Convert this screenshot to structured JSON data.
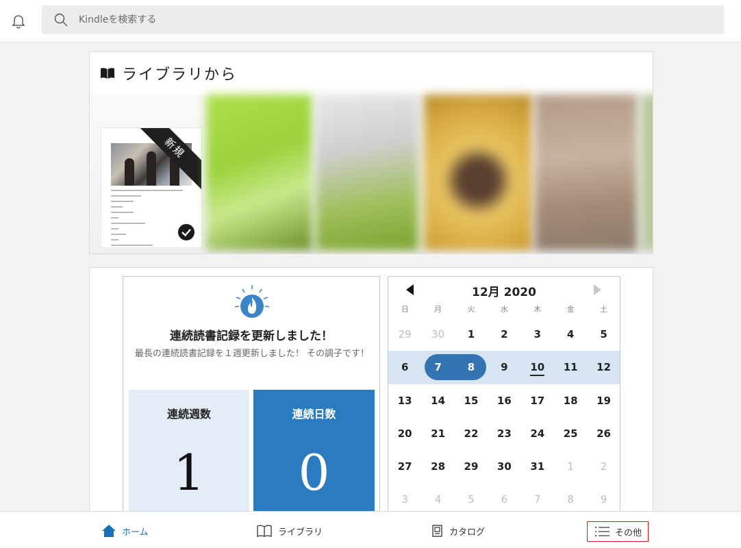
{
  "header": {
    "bell_icon": "bell-icon",
    "search_icon": "search-icon",
    "search_placeholder": "Kindleを検索する"
  },
  "library": {
    "title": "ライブラリから",
    "icon": "open-book-icon",
    "new_badge": "新規",
    "first_book_status_icon": "check-circle-icon"
  },
  "streak": {
    "icon": "flame-icon",
    "heading": "連続読書記録を更新しました！",
    "message": "最長の連続読書記録を１週更新しました！ その調子です！",
    "weeks_label": "連続週数",
    "weeks_value": "1",
    "days_label": "連続日数",
    "days_value": "0"
  },
  "calendar": {
    "title": "12月 2020",
    "weekdays": [
      "日",
      "月",
      "火",
      "水",
      "木",
      "金",
      "土"
    ],
    "weeks": [
      [
        {
          "d": "29",
          "m": true
        },
        {
          "d": "30",
          "m": true
        },
        {
          "d": "1"
        },
        {
          "d": "2"
        },
        {
          "d": "3"
        },
        {
          "d": "4"
        },
        {
          "d": "5"
        }
      ],
      [
        {
          "d": "6"
        },
        {
          "d": "7",
          "s": true
        },
        {
          "d": "8",
          "s": true
        },
        {
          "d": "9"
        },
        {
          "d": "10",
          "t": true
        },
        {
          "d": "11"
        },
        {
          "d": "12"
        }
      ],
      [
        {
          "d": "13"
        },
        {
          "d": "14"
        },
        {
          "d": "15"
        },
        {
          "d": "16"
        },
        {
          "d": "17"
        },
        {
          "d": "18"
        },
        {
          "d": "19"
        }
      ],
      [
        {
          "d": "20"
        },
        {
          "d": "21"
        },
        {
          "d": "22"
        },
        {
          "d": "23"
        },
        {
          "d": "24"
        },
        {
          "d": "25"
        },
        {
          "d": "26"
        }
      ],
      [
        {
          "d": "27"
        },
        {
          "d": "28"
        },
        {
          "d": "29"
        },
        {
          "d": "30"
        },
        {
          "d": "31"
        },
        {
          "d": "1",
          "m": true
        },
        {
          "d": "2",
          "m": true
        }
      ],
      [
        {
          "d": "3",
          "m": true
        },
        {
          "d": "4",
          "m": true
        },
        {
          "d": "5",
          "m": true
        },
        {
          "d": "6",
          "m": true
        },
        {
          "d": "7",
          "m": true
        },
        {
          "d": "8",
          "m": true
        },
        {
          "d": "9",
          "m": true
        }
      ]
    ]
  },
  "bottom_nav": {
    "home": "ホーム",
    "library": "ライブラリ",
    "catalog": "カタログ",
    "more": "その他"
  },
  "colors": {
    "accent": "#2a7bbf",
    "highlight_week": "#d7e4f2",
    "selected_pill": "#3574b3",
    "more_outline": "#d32020"
  }
}
